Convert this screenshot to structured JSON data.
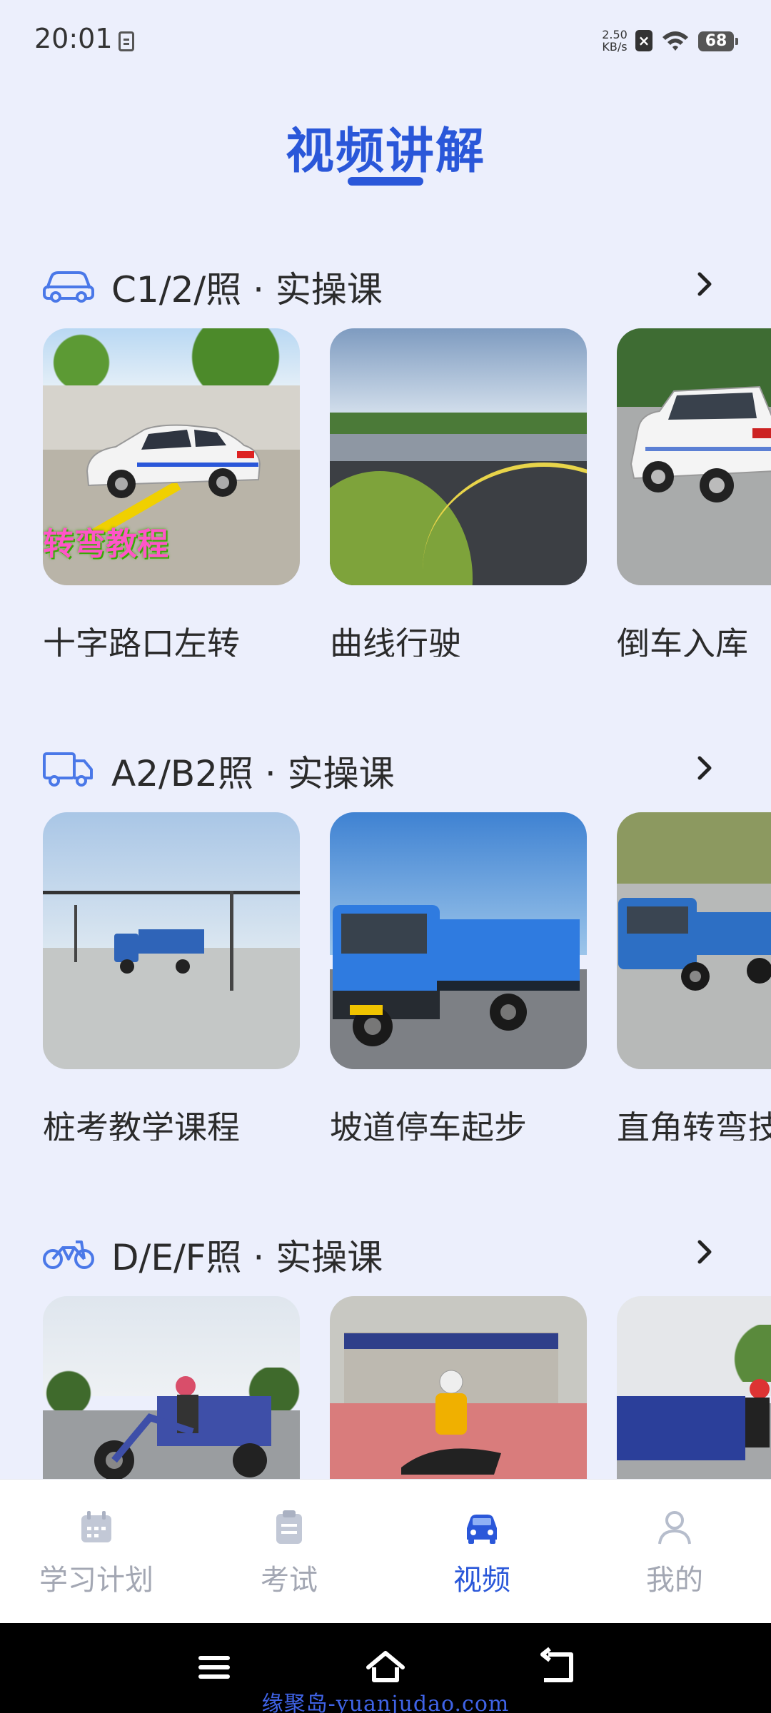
{
  "status_bar": {
    "time": "20:01",
    "net_speed_value": "2.50",
    "net_speed_unit": "KB/s",
    "battery": "68"
  },
  "page": {
    "title": "视频讲解"
  },
  "sections": [
    {
      "title": "C1/2/照 · 实操课",
      "icon": "car-icon",
      "cards": [
        {
          "label": "十字路口左转",
          "overlay": "转弯教程"
        },
        {
          "label": "曲线行驶"
        },
        {
          "label": "倒车入库"
        }
      ]
    },
    {
      "title": "A2/B2照 · 实操课",
      "icon": "truck-icon",
      "cards": [
        {
          "label": "桩考教学课程"
        },
        {
          "label": "坡道停车起步"
        },
        {
          "label": "直角转弯技"
        }
      ]
    },
    {
      "title": "D/E/F照 · 实操课",
      "icon": "motorcycle-icon",
      "cards": [
        {
          "label": ""
        },
        {
          "label": ""
        },
        {
          "label": ""
        }
      ]
    }
  ],
  "bottom_nav": [
    {
      "label": "学习计划",
      "icon": "calendar-icon",
      "active": false
    },
    {
      "label": "考试",
      "icon": "clipboard-icon",
      "active": false
    },
    {
      "label": "视频",
      "icon": "car-icon",
      "active": true
    },
    {
      "label": "我的",
      "icon": "user-icon",
      "active": false
    }
  ],
  "colors": {
    "accent": "#2A57D9",
    "background": "#ECEFFC",
    "inactive": "#A3A7B3"
  },
  "watermark": "缘聚岛-yuanjudao.com"
}
